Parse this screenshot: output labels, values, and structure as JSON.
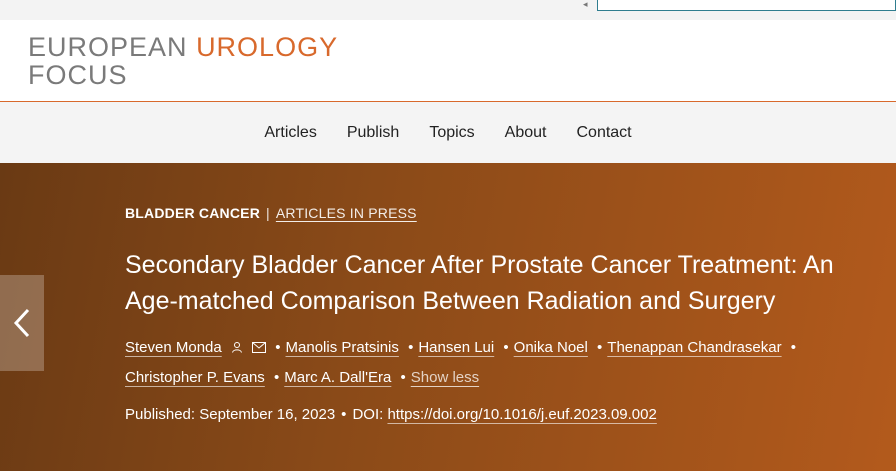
{
  "logo": {
    "line1_gray": "EUROPEAN",
    "line1_accent": "UROLOGY",
    "line2": "FOCUS"
  },
  "nav": {
    "items": [
      "Articles",
      "Publish",
      "Topics",
      "About",
      "Contact"
    ]
  },
  "breadcrumb": {
    "category": "BLADDER CANCER",
    "separator": "|",
    "section": "ARTICLES IN PRESS"
  },
  "article": {
    "title": "Secondary Bladder Cancer After Prostate Cancer Treatment: An Age-matched Comparison Between Radiation and Surgery",
    "authors": [
      "Steven Monda",
      "Manolis Pratsinis",
      "Hansen Lui",
      "Onika Noel",
      "Thenappan Chandrasekar",
      "Christopher P. Evans",
      "Marc A. Dall'Era"
    ],
    "show_less": "Show less",
    "published_label": "Published:",
    "published_date": "September 16, 2023",
    "doi_label": "DOI:",
    "doi_link": "https://doi.org/10.1016/j.euf.2023.09.002"
  },
  "colors": {
    "accent": "#d8692c",
    "hero_start": "#6a3a14",
    "hero_end": "#b35a1c"
  },
  "icons": {
    "back": "chevron-left-icon",
    "author_profile": "person-icon",
    "author_email": "mail-icon"
  }
}
